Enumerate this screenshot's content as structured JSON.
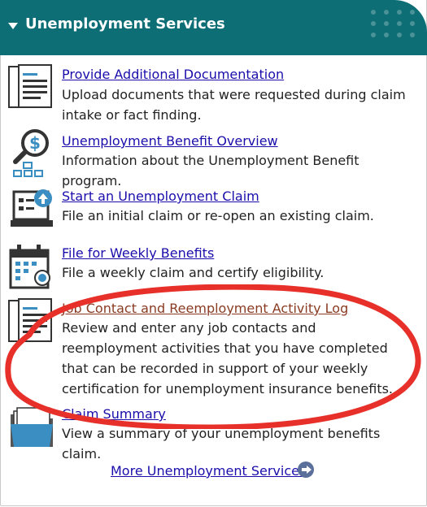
{
  "header": {
    "title": "Unemployment Services"
  },
  "items": [
    {
      "title": "Provide Additional Documentation",
      "description": "Upload documents that were requested during claim intake or fact finding.",
      "icon": "document-icon"
    },
    {
      "title": "Unemployment Benefit Overview",
      "description": "Information about the Unemployment Benefit program.",
      "icon": "dollar-magnifier-icon"
    },
    {
      "title": "Start an Unemployment Claim",
      "description": "File an initial claim or re-open an existing claim.",
      "icon": "laptop-upload-icon"
    },
    {
      "title": "File for Weekly Benefits",
      "description": "File a weekly claim and certify eligibility.",
      "icon": "calendar-icon"
    },
    {
      "title": "Job Contact and Reemployment Activity Log",
      "description": "Review and enter any job contacts and reemployment activities that you have completed that can be recorded in support of your weekly certification for unemployment insurance benefits.",
      "icon": "document-icon"
    },
    {
      "title": "Claim Summary",
      "description": "View a summary of your unemployment benefits claim.",
      "icon": "folder-icon"
    }
  ],
  "more_link": "More Unemployment Services",
  "colors": {
    "header_bg": "#0e6e75",
    "link": "#1a0dab",
    "visited_link": "#8a3b22",
    "highlight_ellipse": "#e8302a"
  }
}
